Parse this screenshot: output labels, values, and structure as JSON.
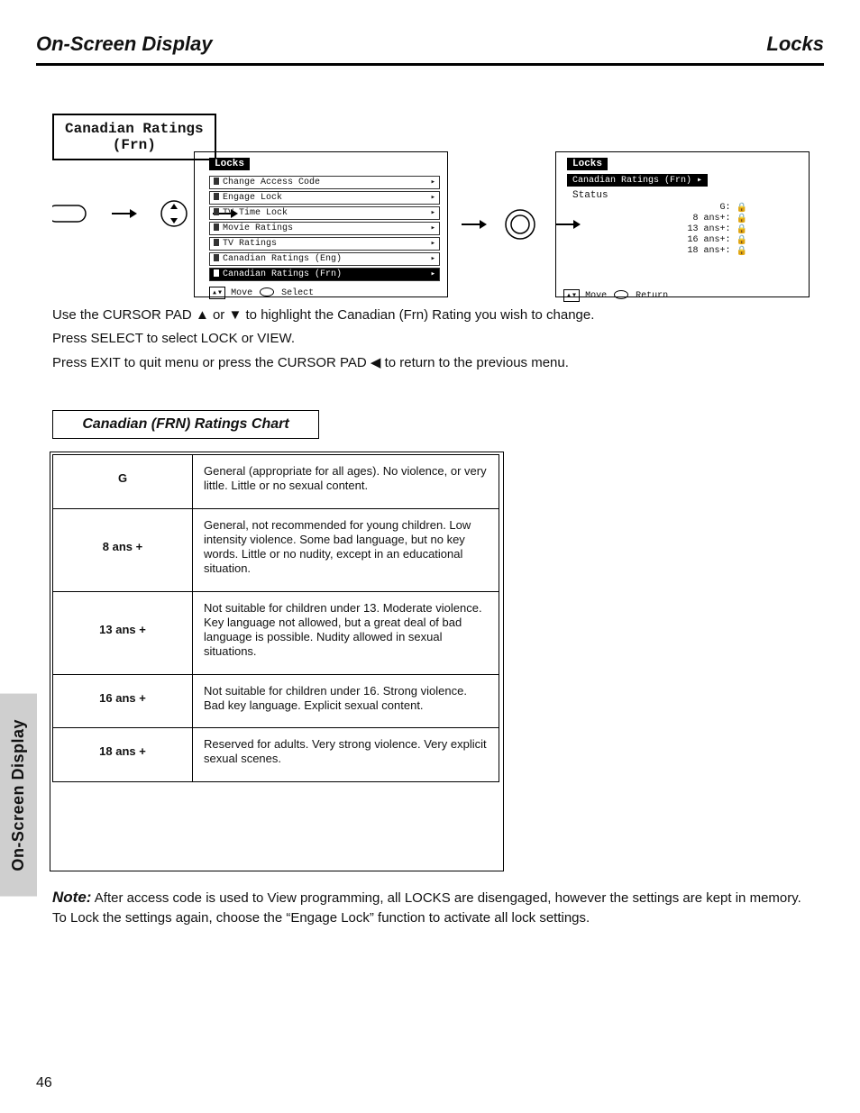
{
  "side_tab": "On-Screen Display",
  "header": {
    "left": "On-Screen Display",
    "right": "Locks"
  },
  "badge": "Canadian Ratings\n(Frn)",
  "instructions": {
    "line1_pre": "Use the CURSOR PAD ",
    "line1_post": " to highlight the Canadian (Frn) Rating you wish to change.",
    "line2": "Press SELECT to select LOCK or VIEW.",
    "line3_pre": "Press EXIT to quit menu or press the CURSOR PAD ",
    "line3_post": " to return to the previous menu."
  },
  "chart_title": "Canadian (FRN) Ratings Chart",
  "ratings_table": [
    {
      "code": "G",
      "desc": "General (appropriate for all ages). No violence, or very little. Little or no sexual content."
    },
    {
      "code": "8 ans +",
      "desc": "General, not recommended for young children. Low intensity violence. Some bad language, but no key words. Little or no nudity, except in an educational situation."
    },
    {
      "code": "13 ans +",
      "desc": "Not suitable for children under 13. Moderate violence. Key language not allowed, but a great deal of bad language is possible. Nudity allowed in sexual situations."
    },
    {
      "code": "16 ans +",
      "desc": "Not suitable for children under 16. Strong violence. Bad key language. Explicit sexual content."
    },
    {
      "code": "18 ans +",
      "desc": "Reserved for adults. Very strong violence. Very explicit sexual scenes."
    }
  ],
  "screens": {
    "left": {
      "title": "Locks",
      "items": [
        {
          "label": "Change Access Code",
          "hl": false
        },
        {
          "label": "Engage Lock",
          "hl": false
        },
        {
          "label": "TV Time Lock",
          "hl": false
        },
        {
          "label": "Movie Ratings",
          "hl": false
        },
        {
          "label": "TV Ratings",
          "hl": false
        },
        {
          "label": "Canadian Ratings (Eng)",
          "hl": false
        },
        {
          "label": "Canadian Ratings (Frn)",
          "hl": true
        }
      ],
      "hint_left": "Move",
      "hint_right": "Select"
    },
    "right": {
      "title": "Locks",
      "subtitle": "Canadian Ratings (Frn)",
      "status_label": "Status",
      "rows": [
        {
          "label": "G:"
        },
        {
          "label": "8 ans+:"
        },
        {
          "label": "13 ans+:"
        },
        {
          "label": "16 ans+:"
        },
        {
          "label": "18 ans+:"
        }
      ],
      "hint_left": "Move",
      "hint_right": "Return"
    }
  },
  "note": {
    "head": "Note:",
    "body": "After access code is used to View programming, all LOCKS are disengaged, however the settings are kept in memory. To Lock the settings again, choose the “Engage Lock” function to activate all lock settings."
  },
  "page_no": "46"
}
